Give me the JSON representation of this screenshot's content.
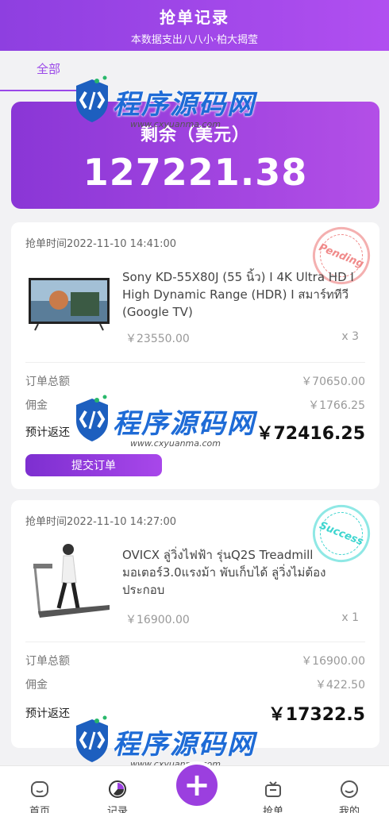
{
  "header": {
    "title": "抢单记录",
    "subtitle": "本数据支出八八小·柏大揭莹"
  },
  "tabs": {
    "all_label": "全部"
  },
  "balance": {
    "label": "剩余（美元）",
    "value": "127221.38"
  },
  "orders": [
    {
      "time": "抢单时间2022-11-10 14:41:00",
      "status": "Pending",
      "product_name": "Sony KD-55X80J (55 นิ้ว) I 4K Ultra HD I High Dynamic Range (HDR) I สมาร์ททีวี (Google TV)",
      "price": "￥23550.00",
      "qty": "x 3",
      "total_label": "订单总额",
      "total_value": "￥70650.00",
      "commission_label": "佣金",
      "commission_value": "￥1766.25",
      "return_label": "预计返还",
      "return_value": "￥72416.25",
      "submit_label": "提交订单"
    },
    {
      "time": "抢单时间2022-11-10 14:27:00",
      "status": "Success",
      "product_name": "OVICX ลู่วิ่งไฟฟ้า รุ่นQ2S Treadmill มอเตอร์3.0แรงม้า พับเก็บได้ ลู่วิ่งไม่ต้องประกอบ",
      "price": "￥16900.00",
      "qty": "x 1",
      "total_label": "订单总额",
      "total_value": "￥16900.00",
      "commission_label": "佣金",
      "commission_value": "￥422.50",
      "return_label": "预计返还",
      "return_value": "￥17322.5"
    }
  ],
  "watermark": {
    "text": "程序源码网",
    "url": "www.cxyuanma.com"
  },
  "bottom_nav": {
    "home": "首页",
    "records": "记录",
    "plus": "+",
    "grab": "抢单",
    "mine": "我的"
  },
  "colors": {
    "accent": "#9b3fdf",
    "pending": "#f08a8a",
    "success": "#3cd5cf"
  }
}
